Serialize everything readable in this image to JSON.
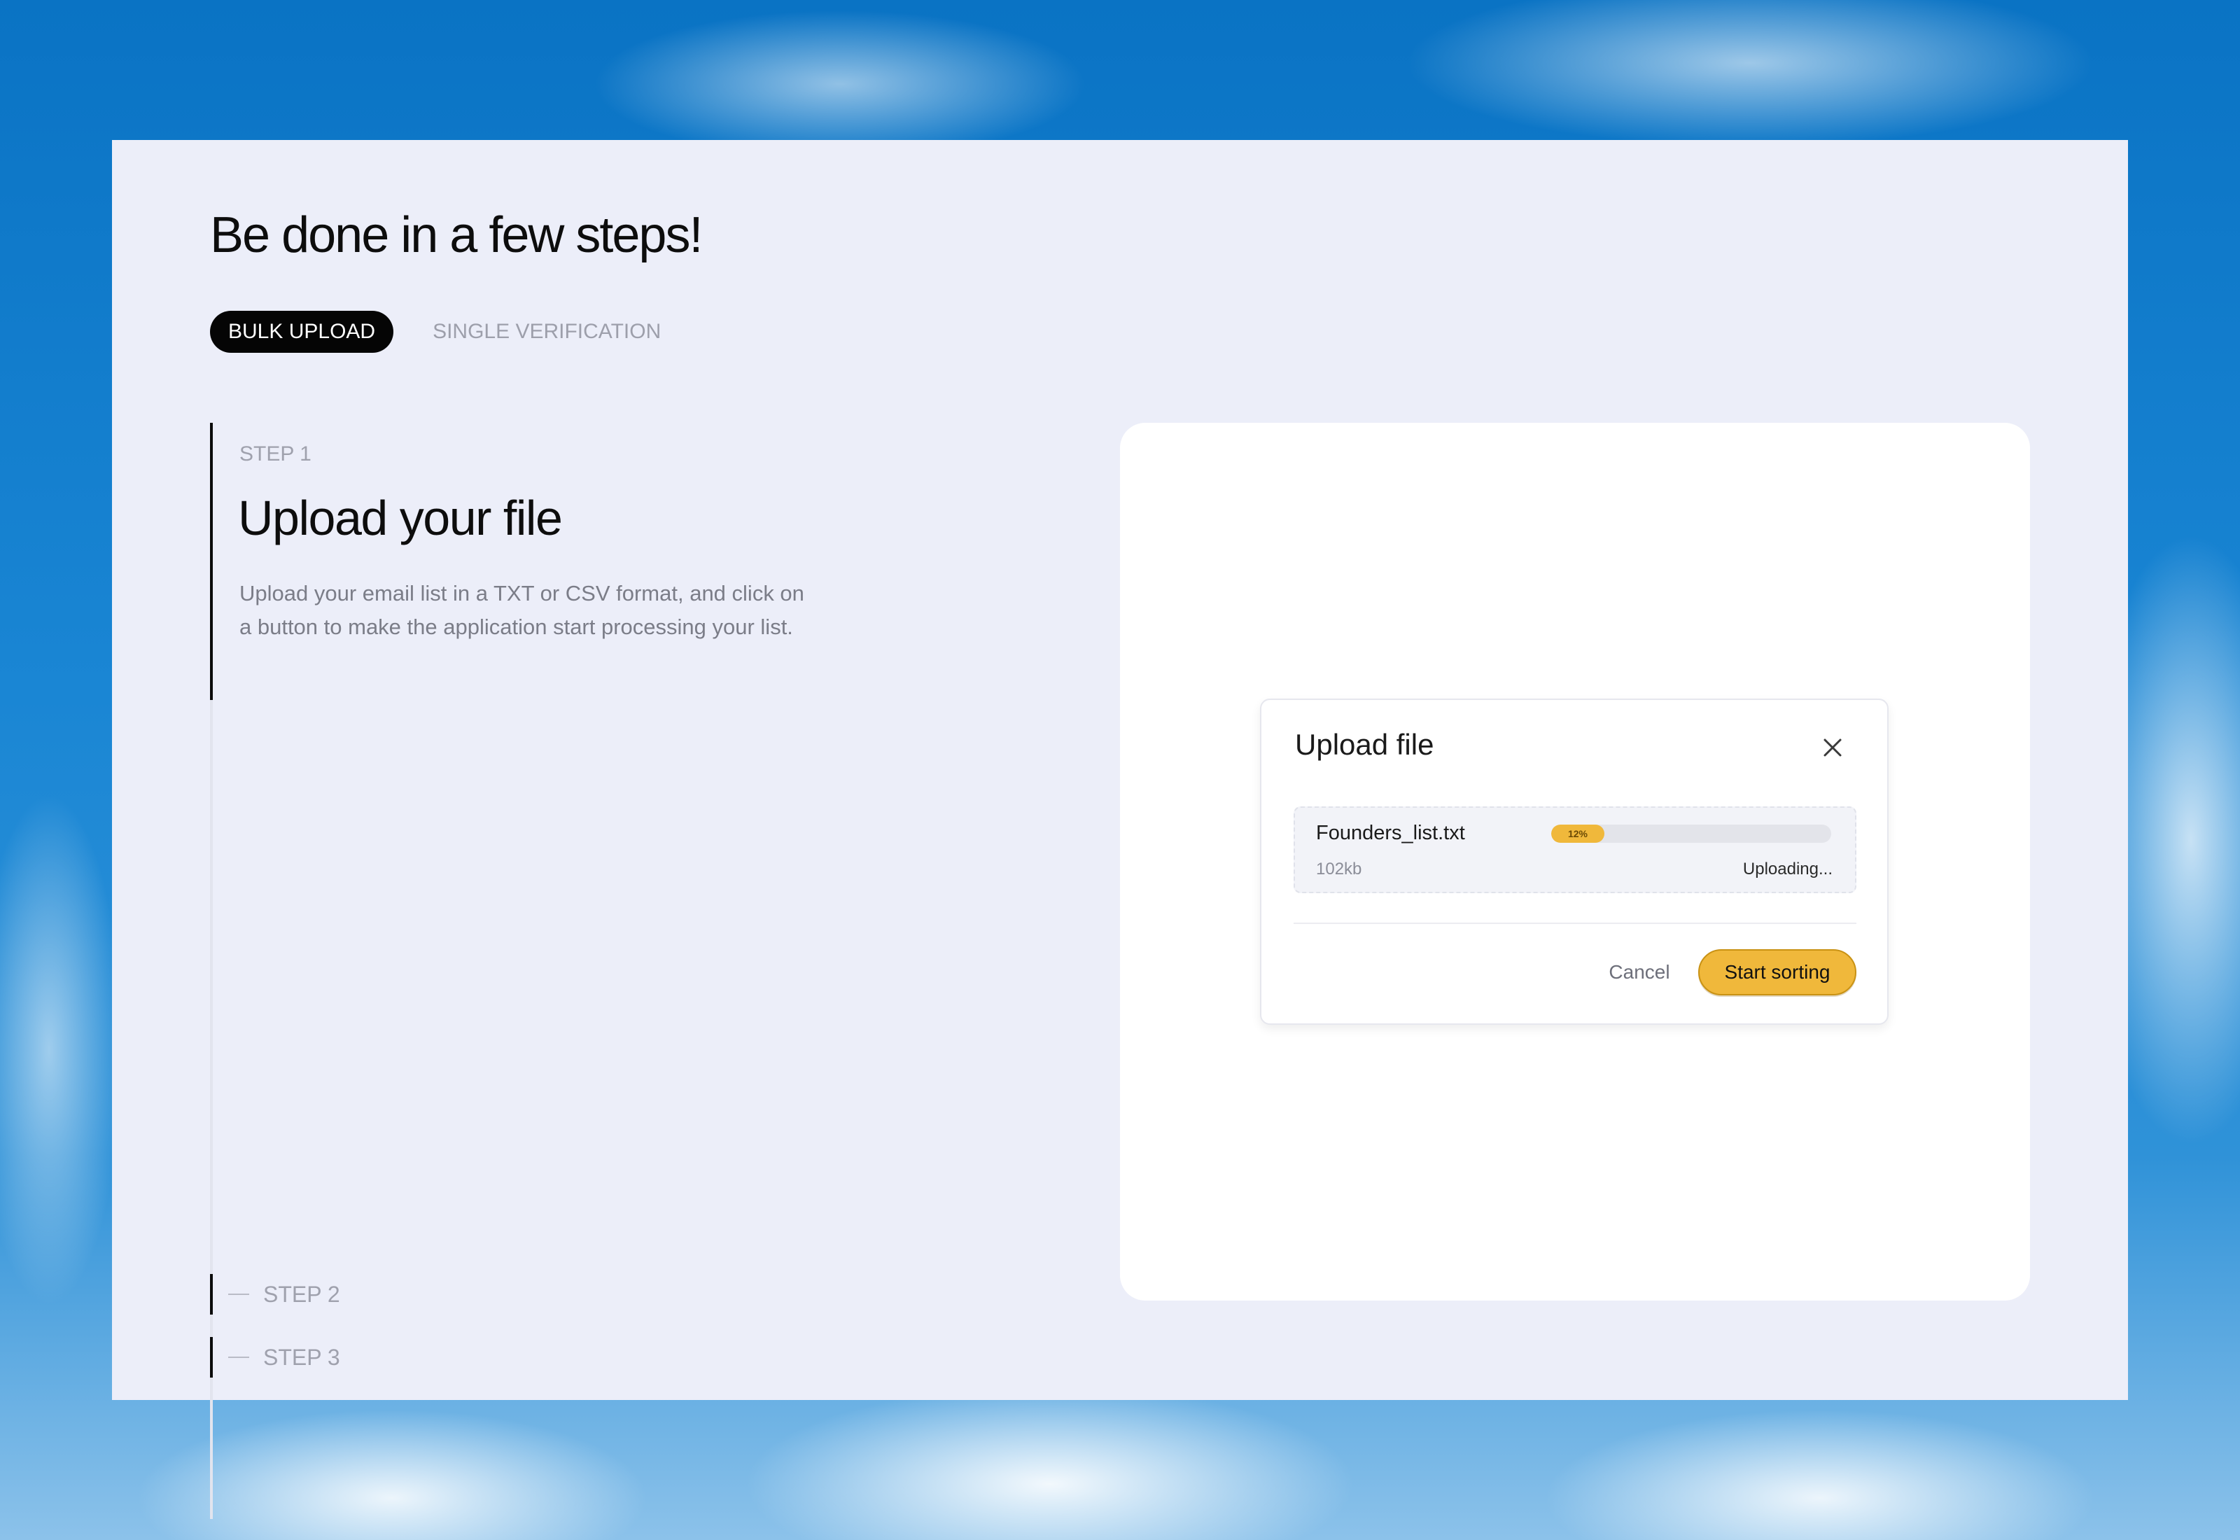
{
  "page": {
    "title": "Be done in a few steps!"
  },
  "tabs": [
    {
      "label": "BULK UPLOAD",
      "active": true
    },
    {
      "label": "SINGLE VERIFICATION",
      "active": false
    }
  ],
  "steps": {
    "current": {
      "label": "STEP 1",
      "heading": "Upload your file",
      "description": "Upload your email list in a TXT or CSV format, and click on a button to make the application start processing your list."
    },
    "upcoming": [
      {
        "label": "STEP 2"
      },
      {
        "label": "STEP 3"
      }
    ]
  },
  "upload_dialog": {
    "title": "Upload file",
    "close_icon": "close-icon",
    "file": {
      "name": "Founders_list.txt",
      "size": "102kb",
      "progress_percent": 12,
      "progress_label": "12%",
      "status": "Uploading..."
    },
    "cancel_label": "Cancel",
    "primary_label": "Start sorting"
  },
  "colors": {
    "accent": "#f0b83b",
    "active_tab_bg": "#050505",
    "panel_bg": "#eceef9",
    "card_bg": "#ffffff"
  }
}
